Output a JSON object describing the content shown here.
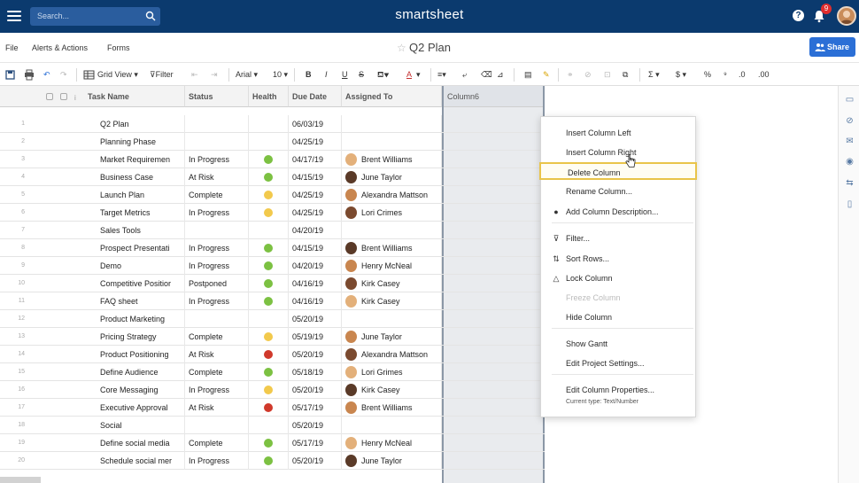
{
  "app": {
    "brand": "smartsheet",
    "search_placeholder": "Search...",
    "notifications_count": "9",
    "help_label": "?"
  },
  "menubar": {
    "items": [
      "File",
      "Alerts & Actions",
      "Forms"
    ],
    "sheet_title": "Q2 Plan",
    "share_label": "Share"
  },
  "toolbar": {
    "view_label": "Grid View",
    "filter_label": "Filter",
    "font_label": "Arial",
    "size_label": "10",
    "bold": "B",
    "italic": "I",
    "underline": "U",
    "strike": "S",
    "currency": "$",
    "percent": "%",
    "sum": "Σ"
  },
  "grid": {
    "columns": [
      "Task Name",
      "Status",
      "Health",
      "Due Date",
      "Assigned To",
      "Column6"
    ],
    "rows": [
      {
        "num": "1",
        "task": "Q2 Plan",
        "status": "",
        "health": "",
        "due": "06/03/19",
        "assigned": ""
      },
      {
        "num": "2",
        "task": "Planning Phase",
        "status": "",
        "health": "",
        "due": "04/25/19",
        "assigned": ""
      },
      {
        "num": "3",
        "task": "Market Requiremen",
        "status": "In Progress",
        "health": "green",
        "due": "04/17/19",
        "assigned": "Brent Williams"
      },
      {
        "num": "4",
        "task": "Business Case",
        "status": "At Risk",
        "health": "green",
        "due": "04/15/19",
        "assigned": "June Taylor"
      },
      {
        "num": "5",
        "task": "Launch Plan",
        "status": "Complete",
        "health": "yellow",
        "due": "04/25/19",
        "assigned": "Alexandra Mattson"
      },
      {
        "num": "6",
        "task": "Target Metrics",
        "status": "In Progress",
        "health": "yellow",
        "due": "04/25/19",
        "assigned": "Lori Crimes"
      },
      {
        "num": "7",
        "task": "Sales Tools",
        "status": "",
        "health": "",
        "due": "04/20/19",
        "assigned": ""
      },
      {
        "num": "8",
        "task": "Prospect Presentati",
        "status": "In Progress",
        "health": "green",
        "due": "04/15/19",
        "assigned": "Brent Williams"
      },
      {
        "num": "9",
        "task": "Demo",
        "status": "In Progress",
        "health": "green",
        "due": "04/20/19",
        "assigned": "Henry McNeal"
      },
      {
        "num": "10",
        "task": "Competitive Positior",
        "status": "Postponed",
        "health": "green",
        "due": "04/16/19",
        "assigned": "Kirk Casey"
      },
      {
        "num": "11",
        "task": "FAQ sheet",
        "status": "In Progress",
        "health": "green",
        "due": "04/16/19",
        "assigned": "Kirk Casey"
      },
      {
        "num": "12",
        "task": "Product Marketing",
        "status": "",
        "health": "",
        "due": "05/20/19",
        "assigned": ""
      },
      {
        "num": "13",
        "task": "Pricing Strategy",
        "status": "Complete",
        "health": "yellow",
        "due": "05/19/19",
        "assigned": "June Taylor"
      },
      {
        "num": "14",
        "task": "Product Positioning",
        "status": "At Risk",
        "health": "red",
        "due": "05/20/19",
        "assigned": "Alexandra Mattson"
      },
      {
        "num": "15",
        "task": "Define Audience",
        "status": "Complete",
        "health": "green",
        "due": "05/18/19",
        "assigned": "Lori Grimes"
      },
      {
        "num": "16",
        "task": "Core Messaging",
        "status": "In Progress",
        "health": "yellow",
        "due": "05/20/19",
        "assigned": "Kirk Casey"
      },
      {
        "num": "17",
        "task": "Executive Approval",
        "status": "At Risk",
        "health": "red",
        "due": "05/17/19",
        "assigned": "Brent Williams"
      },
      {
        "num": "18",
        "task": "Social",
        "status": "",
        "health": "",
        "due": "05/20/19",
        "assigned": ""
      },
      {
        "num": "19",
        "task": "Define social media",
        "status": "Complete",
        "health": "green",
        "due": "05/17/19",
        "assigned": "Henry McNeal"
      },
      {
        "num": "20",
        "task": "Schedule social mer",
        "status": "In Progress",
        "health": "green",
        "due": "05/20/19",
        "assigned": "June Taylor"
      }
    ]
  },
  "context_menu": {
    "items": [
      {
        "label": "Insert Column Left",
        "icon": "",
        "disabled": false,
        "highlight": false
      },
      {
        "label": "Insert Column Right",
        "icon": "",
        "disabled": false,
        "highlight": false
      },
      {
        "label": "Delete Column",
        "icon": "",
        "disabled": false,
        "highlight": true
      },
      {
        "label": "Rename Column...",
        "icon": "",
        "disabled": false,
        "highlight": false
      },
      {
        "label": "Add Column Description...",
        "icon": "info-icon",
        "disabled": false,
        "highlight": false
      },
      {
        "label": "Filter...",
        "icon": "filter-icon",
        "disabled": false,
        "highlight": false
      },
      {
        "label": "Sort Rows...",
        "icon": "sort-icon",
        "disabled": false,
        "highlight": false
      },
      {
        "label": "Lock Column",
        "icon": "lock-icon",
        "disabled": false,
        "highlight": false
      },
      {
        "label": "Freeze Column",
        "icon": "",
        "disabled": true,
        "highlight": false
      },
      {
        "label": "Hide Column",
        "icon": "",
        "disabled": false,
        "highlight": false
      },
      {
        "label": "Show Gantt",
        "icon": "",
        "disabled": false,
        "highlight": false
      },
      {
        "label": "Edit Project Settings...",
        "icon": "",
        "disabled": false,
        "highlight": false
      },
      {
        "label": "Edit Column Properties...",
        "icon": "",
        "disabled": false,
        "highlight": false
      }
    ],
    "current_type": "Current type: Text/Number"
  },
  "colors": {
    "topbar": "#0b3a6e",
    "accent": "#2b6fd6",
    "green": "#7cc142",
    "yellow": "#f2c94c",
    "red": "#d0392b",
    "highlight": "#e9c44a"
  }
}
